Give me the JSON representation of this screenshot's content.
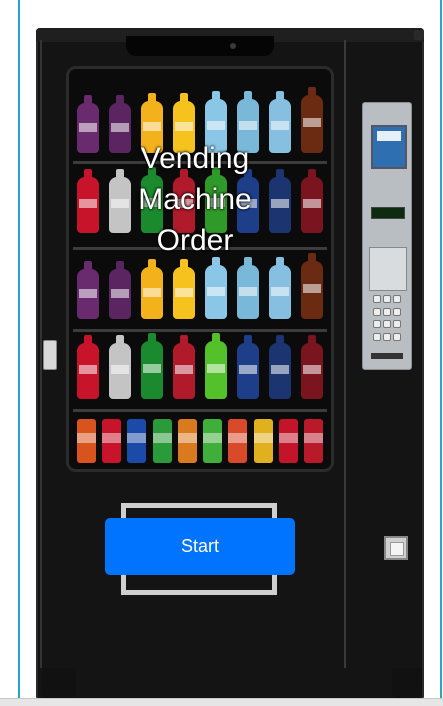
{
  "title": {
    "line1": "Vending",
    "line2": "Machine",
    "line3": "Order"
  },
  "start_button": {
    "label": "Start"
  },
  "colors": {
    "accent": "#0074ff",
    "machine_body": "#141414",
    "frame_lines": "#2aa3c9"
  },
  "icons": {
    "latch": "door-latch-icon",
    "keypad": "keypad-icon",
    "return_door": "return-door-icon"
  }
}
